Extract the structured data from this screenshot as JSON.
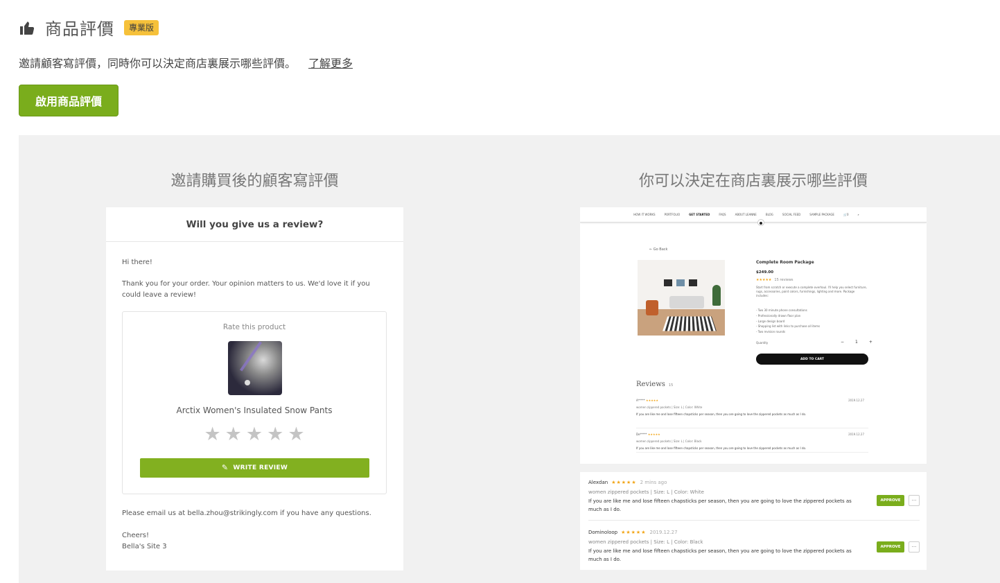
{
  "header": {
    "title": "商品評價",
    "badge": "專業版",
    "description": "邀請顧客寫評價，同時你可以決定商店裏展示哪些評價。",
    "learn_more": "了解更多",
    "enable_button": "啟用商品評價"
  },
  "panel": {
    "left_title": "邀請購買後的顧客寫評價",
    "right_title": "你可以決定在商店裏展示哪些評價"
  },
  "email": {
    "heading": "Will you give us a review?",
    "greeting": "Hi there!",
    "message": "Thank you for your order. Your opinion matters to us. We'd love it if you could leave a review!",
    "rate_label": "Rate this product",
    "product_name": "Arctix Women's Insulated Snow Pants",
    "star_rating": 0,
    "write_review": "WRITE REVIEW",
    "contact": "Please email us at bella.zhou@strikingly.com if you have any questions.",
    "signoff": "Cheers!",
    "site": "Bella's Site 3"
  },
  "store": {
    "nav": [
      "HOW IT WORKS",
      "PORTFOLIO",
      "GET STARTED",
      "FAQS",
      "ABOUT LEANNE",
      "BLOG",
      "SOCIAL FEED",
      "SAMPLE PACKAGE",
      "0"
    ],
    "go_back": "Go Back",
    "product_title": "Complete Room Package",
    "price": "$249.00",
    "rating_stars": "★★★★★",
    "review_count": "15 reviews",
    "description": "Start from scratch or execute a complete overhaul. I'll help you select furniture, rugs, accessories, paint colors, furnishings, lighting and more. Package includes:",
    "bullets": [
      "- Two 30 minute phone consultations",
      "- Professionally drawn floor plan",
      "- Large design board",
      "- Shopping list with links to purchase all items",
      "- Two revision rounds"
    ],
    "quantity_label": "Quantity",
    "quantity": "1",
    "add_to_cart": "ADD TO CART",
    "reviews_title": "Reviews",
    "reviews_count": "15",
    "mini_reviews": [
      {
        "name": "A*****",
        "stars": "★★★★★",
        "meta": "women zippered pockets  |  Size: L  |  Color: White",
        "date": "2019.12.27",
        "text": "If you are like me and lose fifteen chapsticks per season, then you are going to love the zippered pockets as much as I do."
      },
      {
        "name": "De*****",
        "stars": "★★★★★",
        "meta": "women zippered pockets  |  Size: L  |  Color: Black",
        "date": "2019.12.27",
        "text": "If you are like me and lose fifteen chapsticks per season, then you are going to love the zippered pockets as much as I do."
      }
    ]
  },
  "manage": {
    "reviews": [
      {
        "name": "Alexdan",
        "stars": "★★★★★",
        "time": "2 mins ago",
        "meta": "women zippered pockets  |  Size: L  |  Color: White",
        "text": "If you are like me and lose fifteen chapsticks per season, then you are going to love the zippered pockets as much as I do.",
        "approve": "APPROVE",
        "more": "···"
      },
      {
        "name": "Dominoloop",
        "stars": "★★★★★",
        "time": "2019.12.27",
        "meta": "women zippered pockets  |  Size: L  |  Color: Black",
        "text": "If you are like me and lose fifteen chapsticks per season, then you are going to love the zippered pockets as much as I do.",
        "approve": "APPROVE",
        "more": "···"
      }
    ]
  },
  "colors": {
    "accent_green": "#7aad1c",
    "badge_yellow": "#f6c13a",
    "star_gold": "#f2a516",
    "panel_gray": "#f1f1f1"
  },
  "icons": {
    "title_icon": "thumbs-up-icon",
    "write_icon": "pencil-icon",
    "rating_icon": "star-icon"
  }
}
